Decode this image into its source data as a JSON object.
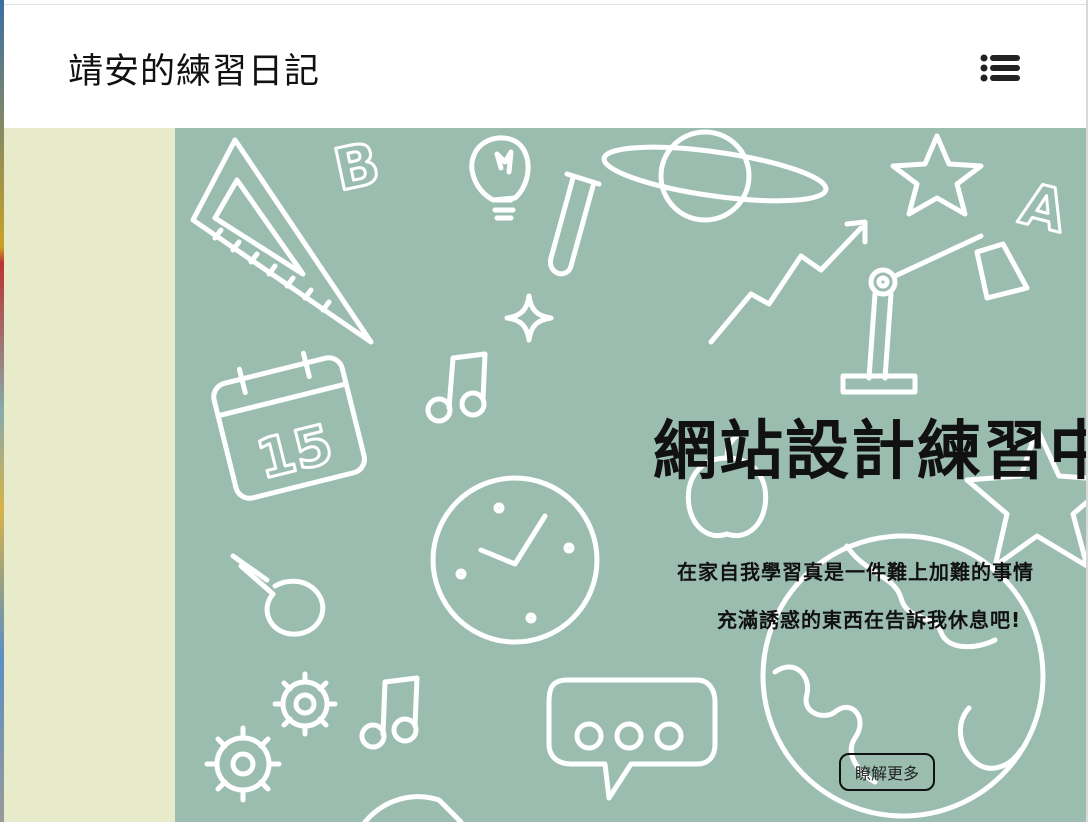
{
  "header": {
    "site_title": "靖安的練習日記",
    "menu_icon": "list-icon"
  },
  "hero": {
    "title": "網站設計練習中",
    "line1": "在家自我學習真是一件難上加難的事情",
    "line2": "充滿誘惑的東西在告訴我休息吧!",
    "button_label": "瞭解更多",
    "calendar_number": "15",
    "letter_b": "B",
    "letter_a": "A"
  },
  "colors": {
    "sidebar_bg": "#e8ebca",
    "hero_bg": "#9bbdb0",
    "doodle_stroke": "#ffffff"
  }
}
